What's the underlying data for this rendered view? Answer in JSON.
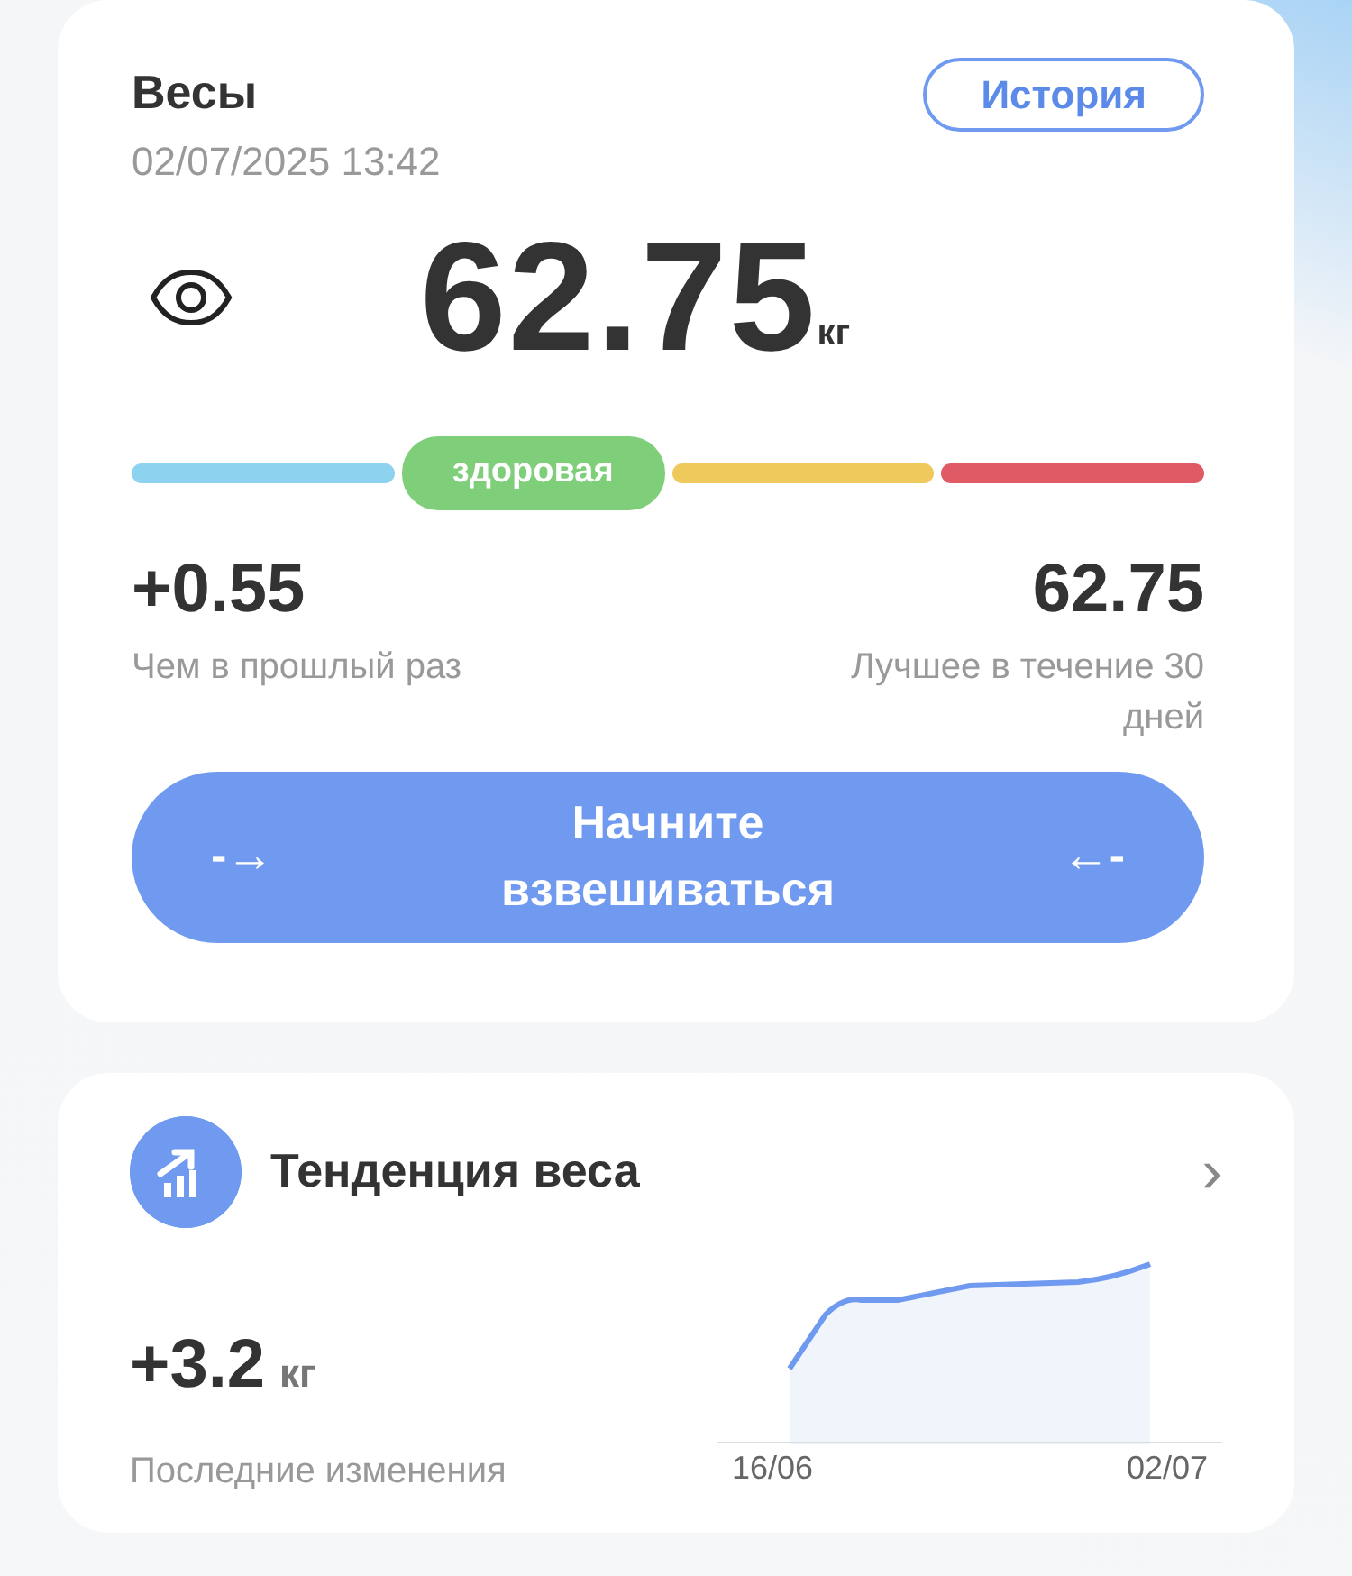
{
  "scale_card": {
    "title": "Весы",
    "history_button": "История",
    "datetime": "02/07/2025 13:42",
    "weight": "62.75",
    "unit": "кг",
    "segments": [
      {
        "color": "#8dd3f0",
        "selected": false
      },
      {
        "color": "#7fcf7a",
        "selected": true,
        "label": "здоровая"
      },
      {
        "color": "#f0c95c",
        "selected": false
      },
      {
        "color": "#e05a66",
        "selected": false
      }
    ],
    "change": {
      "value": "+0.55",
      "caption": "Чем в прошлый раз"
    },
    "best": {
      "value": "62.75",
      "caption": "Лучшее в течение 30 дней"
    },
    "start_button": {
      "label": "Начните взвешиваться",
      "left_arrow": "-→",
      "right_arrow": "←-"
    }
  },
  "trend_card": {
    "title": "Тенденция веса",
    "chevron": "›",
    "value": "+3.2",
    "unit": "кг",
    "caption": "Последние изменения",
    "x_labels": [
      "16/06",
      "02/07"
    ]
  }
}
